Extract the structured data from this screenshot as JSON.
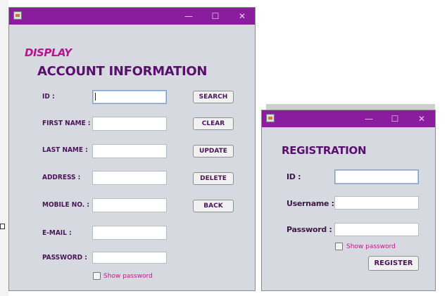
{
  "window1": {
    "controls": {
      "minimize": "—",
      "maximize": "☐",
      "close": "✕"
    },
    "display_label": "DISPLAY",
    "heading": "ACCOUNT INFORMATION",
    "fields": [
      {
        "label": "ID :",
        "value": ""
      },
      {
        "label": "FIRST NAME :",
        "value": ""
      },
      {
        "label": "LAST NAME :",
        "value": ""
      },
      {
        "label": "ADDRESS :",
        "value": ""
      },
      {
        "label": "MOBILE NO. :",
        "value": ""
      },
      {
        "label": "E-MAIL :",
        "value": ""
      },
      {
        "label": "PASSWORD :",
        "value": ""
      }
    ],
    "buttons": [
      "SEARCH",
      "CLEAR",
      "UPDATE",
      "DELETE",
      "BACK"
    ],
    "show_password": "Show password"
  },
  "window2": {
    "controls": {
      "minimize": "—",
      "maximize": "☐",
      "close": "✕"
    },
    "heading": "REGISTRATION",
    "fields": [
      {
        "label": "ID :",
        "value": ""
      },
      {
        "label": "Username :",
        "value": ""
      },
      {
        "label": "Password :",
        "value": ""
      }
    ],
    "show_password": "Show password",
    "register_button": "REGISTER"
  },
  "colors": {
    "titlebar": "#8a1c9e",
    "heading": "#5a0f6e",
    "accent_pink": "#c4178f",
    "window_bg": "#d6d9e0"
  }
}
